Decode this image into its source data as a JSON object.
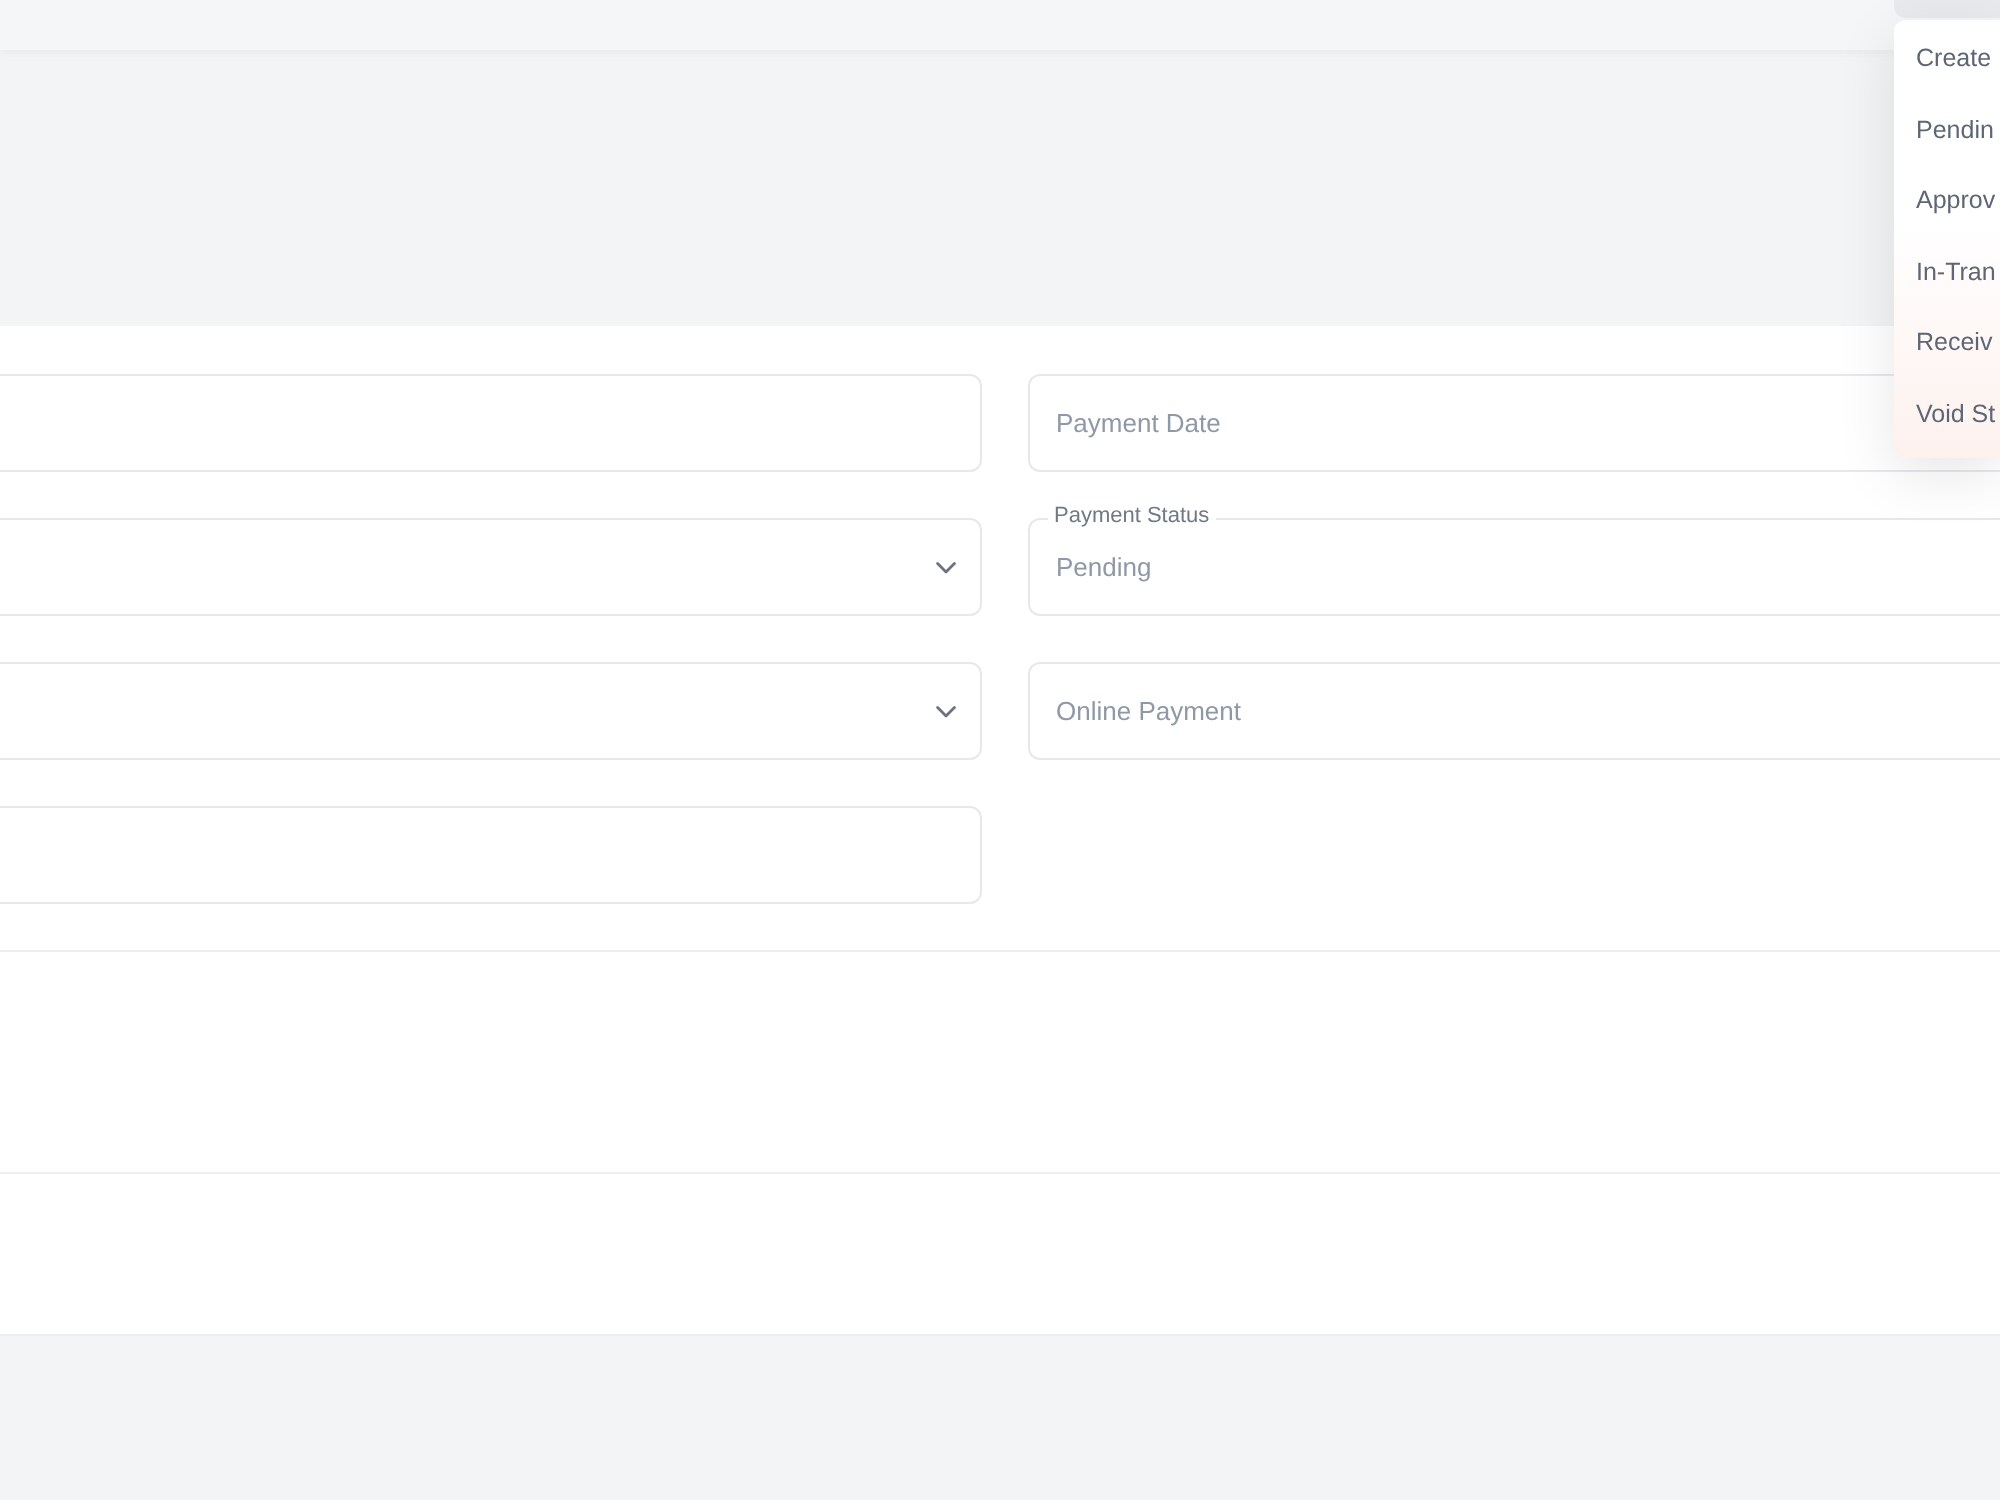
{
  "dropdown_menu": {
    "items": [
      {
        "label": "Create"
      },
      {
        "label": "Pendin"
      },
      {
        "label": "Approv"
      },
      {
        "label": "In-Tran"
      },
      {
        "label": "Receiv"
      },
      {
        "label": "Void St"
      }
    ]
  },
  "form": {
    "rows": [
      {
        "left": {
          "kind": "input"
        },
        "right": {
          "kind": "input",
          "placeholder": "Payment Date"
        }
      },
      {
        "left": {
          "kind": "select"
        },
        "right": {
          "kind": "floating",
          "label": "Payment Status",
          "value": "Pending"
        }
      },
      {
        "left": {
          "kind": "select"
        },
        "right": {
          "kind": "input",
          "placeholder": "Online Payment"
        }
      },
      {
        "left": {
          "kind": "input"
        }
      }
    ]
  }
}
